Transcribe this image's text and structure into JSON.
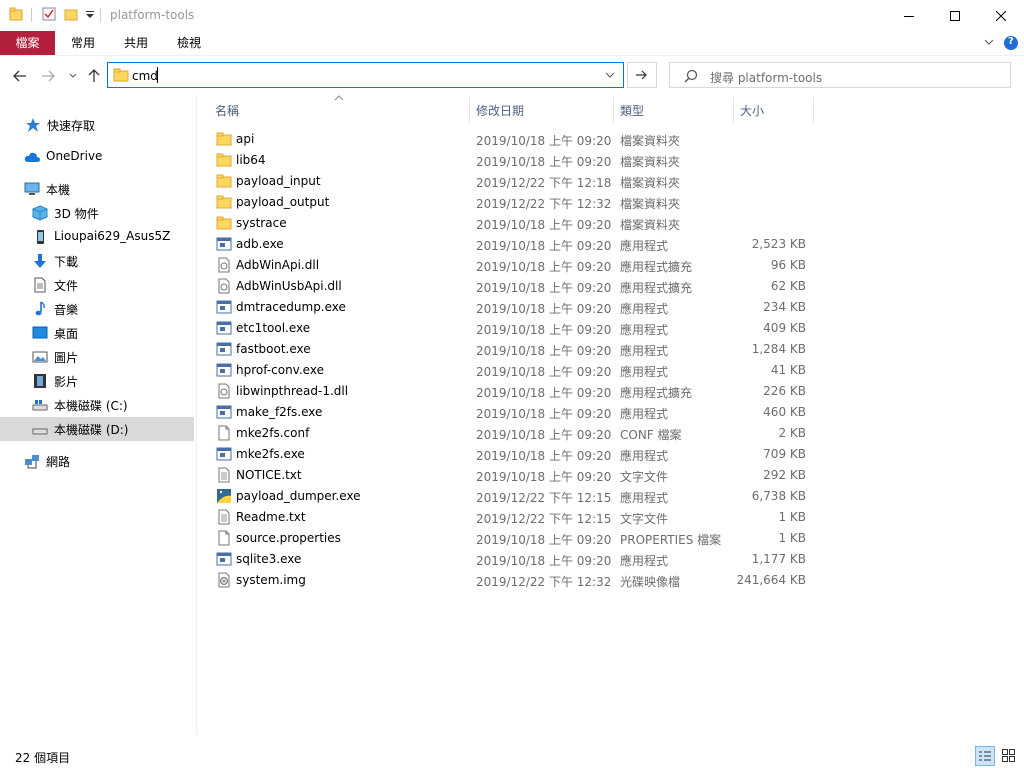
{
  "window": {
    "title": "platform-tools"
  },
  "ribbon": {
    "tabs": [
      "檔案",
      "常用",
      "共用",
      "檢視"
    ]
  },
  "address": {
    "value": "cmd"
  },
  "search": {
    "placeholder": "搜尋 platform-tools"
  },
  "nav": {
    "items": [
      {
        "label": "快速存取",
        "icon": "star-icon"
      },
      {
        "label": "OneDrive",
        "icon": "cloud-icon"
      },
      {
        "label": "本機",
        "icon": "computer-icon"
      },
      {
        "label": "3D 物件",
        "icon": "cube-icon"
      },
      {
        "label": "Lioupai629_Asus5Z",
        "icon": "phone-icon"
      },
      {
        "label": "下載",
        "icon": "download-icon"
      },
      {
        "label": "文件",
        "icon": "document-icon"
      },
      {
        "label": "音樂",
        "icon": "music-icon"
      },
      {
        "label": "桌面",
        "icon": "desktop-icon"
      },
      {
        "label": "圖片",
        "icon": "picture-icon"
      },
      {
        "label": "影片",
        "icon": "video-icon"
      },
      {
        "label": "本機磁碟 (C:)",
        "icon": "drive-icon"
      },
      {
        "label": "本機磁碟 (D:)",
        "icon": "drive-icon"
      },
      {
        "label": "網路",
        "icon": "network-icon"
      }
    ]
  },
  "columns": {
    "name": "名稱",
    "date": "修改日期",
    "type": "類型",
    "size": "大小"
  },
  "files": [
    {
      "name": "api",
      "date": "2019/10/18 上午 09:20",
      "type": "檔案資料夾",
      "size": "",
      "kind": "folder"
    },
    {
      "name": "lib64",
      "date": "2019/10/18 上午 09:20",
      "type": "檔案資料夾",
      "size": "",
      "kind": "folder"
    },
    {
      "name": "payload_input",
      "date": "2019/12/22 下午 12:18",
      "type": "檔案資料夾",
      "size": "",
      "kind": "folder"
    },
    {
      "name": "payload_output",
      "date": "2019/12/22 下午 12:32",
      "type": "檔案資料夾",
      "size": "",
      "kind": "folder"
    },
    {
      "name": "systrace",
      "date": "2019/10/18 上午 09:20",
      "type": "檔案資料夾",
      "size": "",
      "kind": "folder"
    },
    {
      "name": "adb.exe",
      "date": "2019/10/18 上午 09:20",
      "type": "應用程式",
      "size": "2,523 KB",
      "kind": "exe"
    },
    {
      "name": "AdbWinApi.dll",
      "date": "2019/10/18 上午 09:20",
      "type": "應用程式擴充",
      "size": "96 KB",
      "kind": "dll"
    },
    {
      "name": "AdbWinUsbApi.dll",
      "date": "2019/10/18 上午 09:20",
      "type": "應用程式擴充",
      "size": "62 KB",
      "kind": "dll"
    },
    {
      "name": "dmtracedump.exe",
      "date": "2019/10/18 上午 09:20",
      "type": "應用程式",
      "size": "234 KB",
      "kind": "exe"
    },
    {
      "name": "etc1tool.exe",
      "date": "2019/10/18 上午 09:20",
      "type": "應用程式",
      "size": "409 KB",
      "kind": "exe"
    },
    {
      "name": "fastboot.exe",
      "date": "2019/10/18 上午 09:20",
      "type": "應用程式",
      "size": "1,284 KB",
      "kind": "exe"
    },
    {
      "name": "hprof-conv.exe",
      "date": "2019/10/18 上午 09:20",
      "type": "應用程式",
      "size": "41 KB",
      "kind": "exe"
    },
    {
      "name": "libwinpthread-1.dll",
      "date": "2019/10/18 上午 09:20",
      "type": "應用程式擴充",
      "size": "226 KB",
      "kind": "dll"
    },
    {
      "name": "make_f2fs.exe",
      "date": "2019/10/18 上午 09:20",
      "type": "應用程式",
      "size": "460 KB",
      "kind": "exe"
    },
    {
      "name": "mke2fs.conf",
      "date": "2019/10/18 上午 09:20",
      "type": "CONF 檔案",
      "size": "2 KB",
      "kind": "file"
    },
    {
      "name": "mke2fs.exe",
      "date": "2019/10/18 上午 09:20",
      "type": "應用程式",
      "size": "709 KB",
      "kind": "exe"
    },
    {
      "name": "NOTICE.txt",
      "date": "2019/10/18 上午 09:20",
      "type": "文字文件",
      "size": "292 KB",
      "kind": "txt"
    },
    {
      "name": "payload_dumper.exe",
      "date": "2019/12/22 下午 12:15",
      "type": "應用程式",
      "size": "6,738 KB",
      "kind": "pyexe"
    },
    {
      "name": "Readme.txt",
      "date": "2019/12/22 下午 12:15",
      "type": "文字文件",
      "size": "1 KB",
      "kind": "txt"
    },
    {
      "name": "source.properties",
      "date": "2019/10/18 上午 09:20",
      "type": "PROPERTIES 檔案",
      "size": "1 KB",
      "kind": "file"
    },
    {
      "name": "sqlite3.exe",
      "date": "2019/10/18 上午 09:20",
      "type": "應用程式",
      "size": "1,177 KB",
      "kind": "exe"
    },
    {
      "name": "system.img",
      "date": "2019/12/22 下午 12:32",
      "type": "光碟映像檔",
      "size": "241,664 KB",
      "kind": "img"
    }
  ],
  "status": {
    "count": "22 個項目"
  },
  "colors": {
    "file_tab": "#b3203d",
    "address_border": "#0078d7",
    "selected_nav": "#d9d9d9",
    "column_header": "#4d6082",
    "folder": "#ffd75e"
  }
}
